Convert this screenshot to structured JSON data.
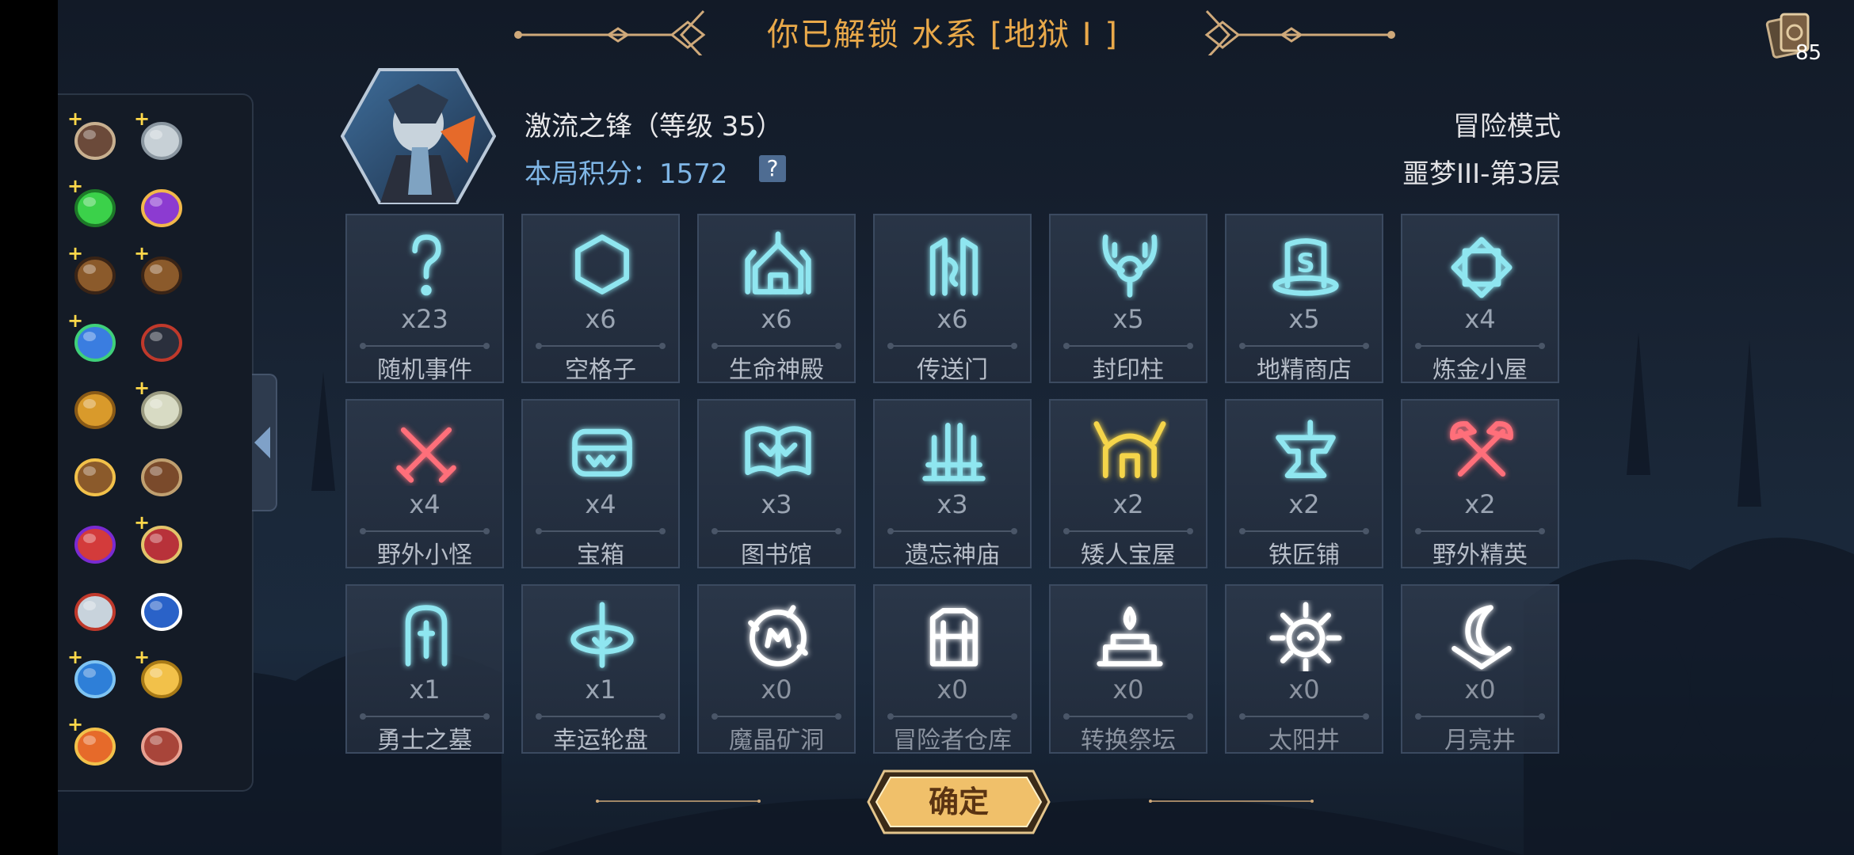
{
  "title": {
    "unlock_text": "你已解锁 水系 [地狱 I ]"
  },
  "deck": {
    "count": "85"
  },
  "hero": {
    "name": "激流之锋（等级 35）",
    "score_label": "本局积分：",
    "score_value": "1572",
    "help": "?"
  },
  "mode": {
    "label": "冒险模式",
    "stage": "噩梦III-第3层"
  },
  "items": [
    {
      "name": "horn-item",
      "plus": "+"
    },
    {
      "name": "scroll-card-item",
      "plus": "+"
    },
    {
      "name": "green-potion-item",
      "plus": "+"
    },
    {
      "name": "purple-orb-item",
      "plus": ""
    },
    {
      "name": "map-item-1",
      "plus": "+"
    },
    {
      "name": "map-item-2",
      "plus": "+"
    },
    {
      "name": "blue-egg-item",
      "plus": "+"
    },
    {
      "name": "magic-hat-item",
      "plus": ""
    },
    {
      "name": "gloves-item",
      "plus": ""
    },
    {
      "name": "parchment-item",
      "plus": "+"
    },
    {
      "name": "money-bag-item",
      "plus": ""
    },
    {
      "name": "belt-item",
      "plus": ""
    },
    {
      "name": "berries-item",
      "plus": ""
    },
    {
      "name": "red-book-item",
      "plus": "+"
    },
    {
      "name": "amulet-item",
      "plus": ""
    },
    {
      "name": "mystery-card-item",
      "plus": ""
    },
    {
      "name": "blue-ore-item",
      "plus": "+"
    },
    {
      "name": "gold-bars-item",
      "plus": "+"
    },
    {
      "name": "fire-shell-item",
      "plus": "+"
    },
    {
      "name": "meat-item",
      "plus": ""
    }
  ],
  "rooms": [
    {
      "icon": "question-icon",
      "count": "x23",
      "name": "随机事件",
      "color": "#8fe6f0"
    },
    {
      "icon": "hexagon-icon",
      "count": "x6",
      "name": "空格子",
      "color": "#8fe6f0"
    },
    {
      "icon": "temple-icon",
      "count": "x6",
      "name": "生命神殿",
      "color": "#8fe6f0"
    },
    {
      "icon": "portal-icon",
      "count": "x6",
      "name": "传送门",
      "color": "#8fe6f0"
    },
    {
      "icon": "seal-pillar-icon",
      "count": "x5",
      "name": "封印柱",
      "color": "#8fe6f0"
    },
    {
      "icon": "goblin-shop-icon",
      "count": "x5",
      "name": "地精商店",
      "color": "#8fe6f0"
    },
    {
      "icon": "alchemy-icon",
      "count": "x4",
      "name": "炼金小屋",
      "color": "#8fe6f0"
    },
    {
      "icon": "crossed-swords-icon",
      "count": "x4",
      "name": "野外小怪",
      "color": "#ff6f7a"
    },
    {
      "icon": "chest-icon",
      "count": "x4",
      "name": "宝箱",
      "color": "#8fe6f0"
    },
    {
      "icon": "book-icon",
      "count": "x3",
      "name": "图书馆",
      "color": "#8fe6f0"
    },
    {
      "icon": "forgotten-temple-icon",
      "count": "x3",
      "name": "遗忘神庙",
      "color": "#8fe6f0"
    },
    {
      "icon": "dwarf-helmet-icon",
      "count": "x2",
      "name": "矮人宝屋",
      "color": "#f5d54a"
    },
    {
      "icon": "anvil-icon",
      "count": "x2",
      "name": "铁匠铺",
      "color": "#8fe6f0"
    },
    {
      "icon": "crossed-axes-icon",
      "count": "x2",
      "name": "野外精英",
      "color": "#ff6f7a"
    },
    {
      "icon": "tombstone-icon",
      "count": "x1",
      "name": "勇士之墓",
      "color": "#8fe6f0"
    },
    {
      "icon": "wheel-icon",
      "count": "x1",
      "name": "幸运轮盘",
      "color": "#8fe6f0"
    },
    {
      "icon": "crystal-mine-icon",
      "count": "x0",
      "name": "魔晶矿洞",
      "color": "#ffffff"
    },
    {
      "icon": "warehouse-icon",
      "count": "x0",
      "name": "冒险者仓库",
      "color": "#ffffff"
    },
    {
      "icon": "altar-icon",
      "count": "x0",
      "name": "转换祭坛",
      "color": "#ffffff"
    },
    {
      "icon": "sun-well-icon",
      "count": "x0",
      "name": "太阳井",
      "color": "#ffffff"
    },
    {
      "icon": "moon-well-icon",
      "count": "x0",
      "name": "月亮井",
      "color": "#ffffff"
    }
  ],
  "confirm": {
    "label": "确定"
  },
  "colors": {
    "title": "#e9a94a",
    "score": "#7fb6e6",
    "confirm_fill": "#f0c06a"
  }
}
